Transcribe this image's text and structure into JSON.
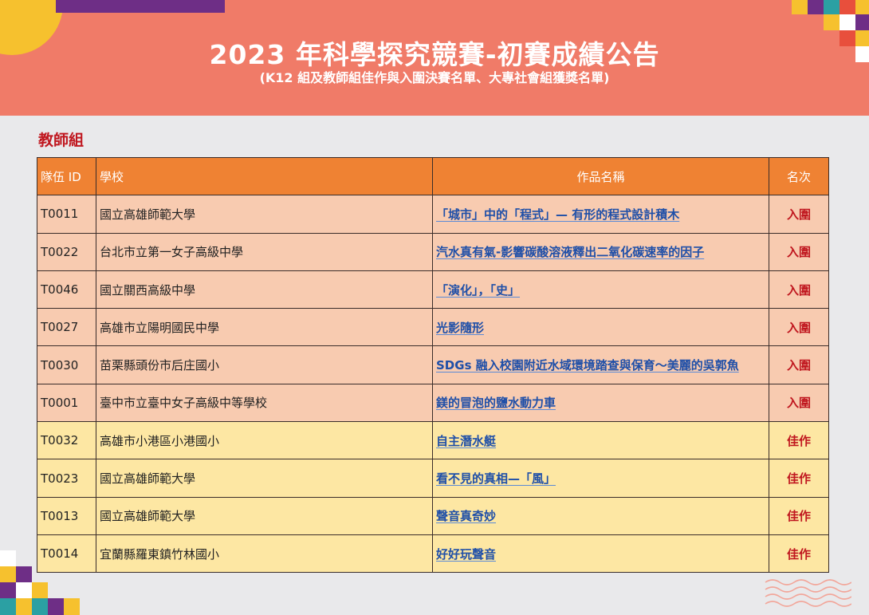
{
  "colors": {
    "header_bg": "#f07b68",
    "page_bg": "#e9e9eb",
    "table_header_bg": "#ef8233",
    "finalist_row_bg": "#f8cbb0",
    "merit_row_bg": "#fde7a3",
    "section_title": "#c0171f",
    "link": "#1f4fa8"
  },
  "header": {
    "title": "2023 年科學探究競賽-初賽成績公告",
    "subtitle": "(K12 組及教師組佳作與入圍決賽名單、大專社會組獲獎名單)"
  },
  "section_title": "教師組",
  "table": {
    "columns": [
      "隊伍 ID",
      "學校",
      "作品名稱",
      "名次"
    ],
    "rows": [
      {
        "id": "T0011",
        "school": "國立高雄師範大學",
        "work": "「城市」中的「程式」— 有形的程式設計積木",
        "rank": "入圍"
      },
      {
        "id": "T0022",
        "school": "台北市立第一女子高級中學",
        "work": "汽水真有氣-影響碳酸溶液釋出二氧化碳速率的因子",
        "rank": "入圍"
      },
      {
        "id": "T0046",
        "school": "國立關西高級中學",
        "work": "「演化」，「史」",
        "rank": "入圍"
      },
      {
        "id": "T0027",
        "school": "高雄市立陽明國民中學",
        "work": "光影隨形",
        "rank": "入圍"
      },
      {
        "id": "T0030",
        "school": "苗栗縣頭份市后庄國小",
        "work": "SDGs 融入校園附近水域環境踏查與保育～美麗的吳郭魚",
        "rank": "入圍"
      },
      {
        "id": "T0001",
        "school": "臺中市立臺中女子高級中等學校",
        "work": "鎂的冒泡的鹽水動力車",
        "rank": "入圍"
      },
      {
        "id": "T0032",
        "school": "高雄市小港區小港國小",
        "work": "自主潛水艇",
        "rank": "佳作"
      },
      {
        "id": "T0023",
        "school": "國立高雄師範大學",
        "work": "看不見的真相—「風」",
        "rank": "佳作"
      },
      {
        "id": "T0013",
        "school": "國立高雄師範大學",
        "work": "聲音真奇妙",
        "rank": "佳作"
      },
      {
        "id": "T0014",
        "school": "宜蘭縣羅東鎮竹林國小",
        "work": "好好玩聲音",
        "rank": "佳作"
      }
    ]
  }
}
